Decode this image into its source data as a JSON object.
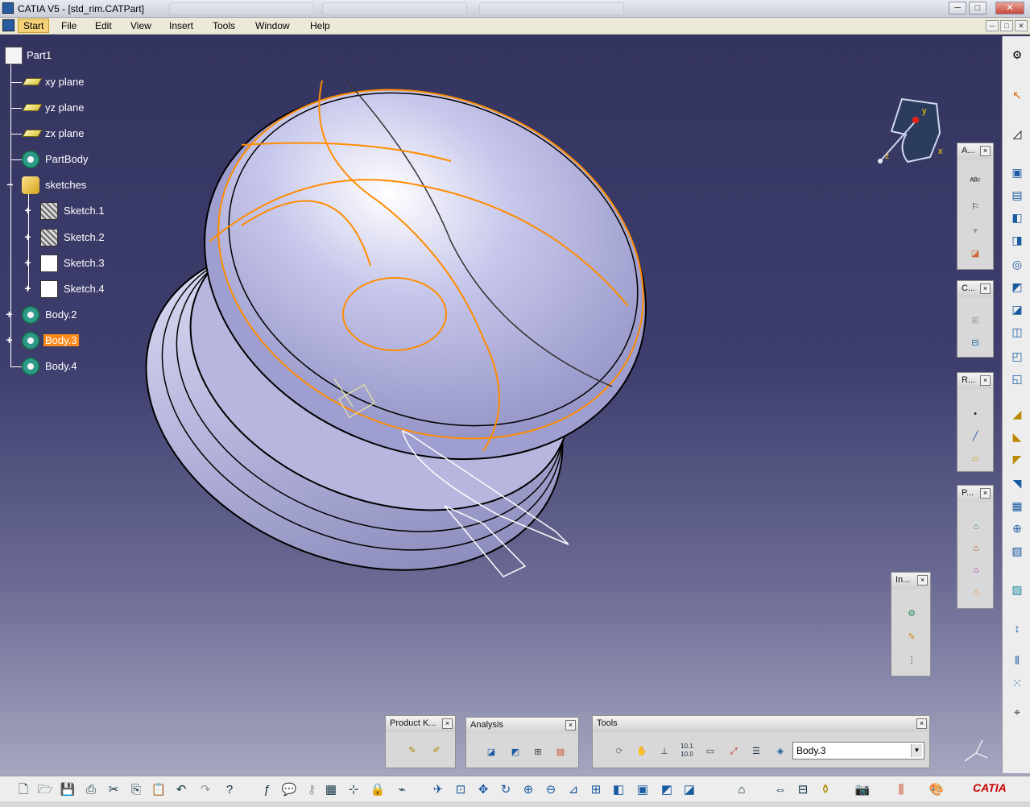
{
  "window": {
    "title": "CATIA V5 - [std_rim.CATPart]",
    "minimize": "─",
    "restore": "□",
    "close": "✕"
  },
  "menu": {
    "items": [
      "Start",
      "File",
      "Edit",
      "View",
      "Insert",
      "Tools",
      "Window",
      "Help"
    ]
  },
  "tree": {
    "root": "Part1",
    "items": [
      "xy plane",
      "yz plane",
      "zx plane",
      "PartBody",
      "sketches",
      "Sketch.1",
      "Sketch.2",
      "Sketch.3",
      "Sketch.4",
      "Body.2",
      "Body.3",
      "Body.4"
    ],
    "selected": "Body.3"
  },
  "compass": {
    "x_label": "x",
    "y_label": "y",
    "z_label": "z"
  },
  "toolbars": {
    "annotations": {
      "title": "A..."
    },
    "constraints": {
      "title": "C..."
    },
    "reference": {
      "title": "R..."
    },
    "pattern": {
      "title": "P..."
    },
    "insert": {
      "title": "In..."
    },
    "product_knowledge": {
      "title": "Product K..."
    },
    "analysis": {
      "title": "Analysis"
    },
    "tools": {
      "title": "Tools",
      "current_body": "Body.3",
      "dims_label": "10.1\n10.0"
    }
  },
  "close_glyph": "×",
  "brand": {
    "logo_text": "CATIA"
  },
  "colors": {
    "background_top": "#33335e",
    "background_bottom": "#b0b0c8",
    "selection": "#ff8a1a",
    "edge_highlight": "#ff8c00",
    "part_surface": "#b8b8e0"
  }
}
